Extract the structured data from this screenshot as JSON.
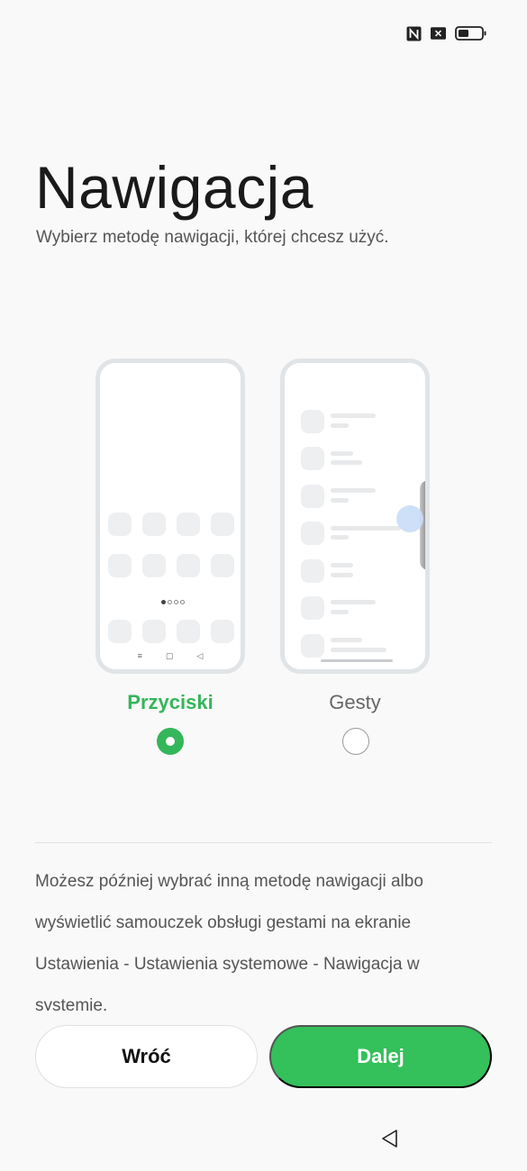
{
  "status_bar": {
    "icons": [
      "nfc-icon",
      "sim-off-icon",
      "battery-icon"
    ],
    "battery_level": 0.4
  },
  "title": "Nawigacja",
  "subtitle": "Wybierz metodę nawigacji, której chcesz użyć.",
  "options": {
    "buttons": {
      "label": "Przyciski",
      "selected": true
    },
    "gestures": {
      "label": "Gesty",
      "selected": false
    }
  },
  "preview_buttons": {
    "nav_icons": [
      "menu-icon",
      "home-square-icon",
      "back-triangle-icon"
    ]
  },
  "info_text": "Możesz później wybrać inną metodę nawigacji albo wyświetlić samouczek obsługi gestami na ekranie Ustawienia - Ustawienia systemowe - Nawigacja w systemie.",
  "buttons": {
    "back": "Wróć",
    "next": "Dalej"
  },
  "colors": {
    "accent": "#34c05a",
    "background": "#f9f9f9"
  }
}
